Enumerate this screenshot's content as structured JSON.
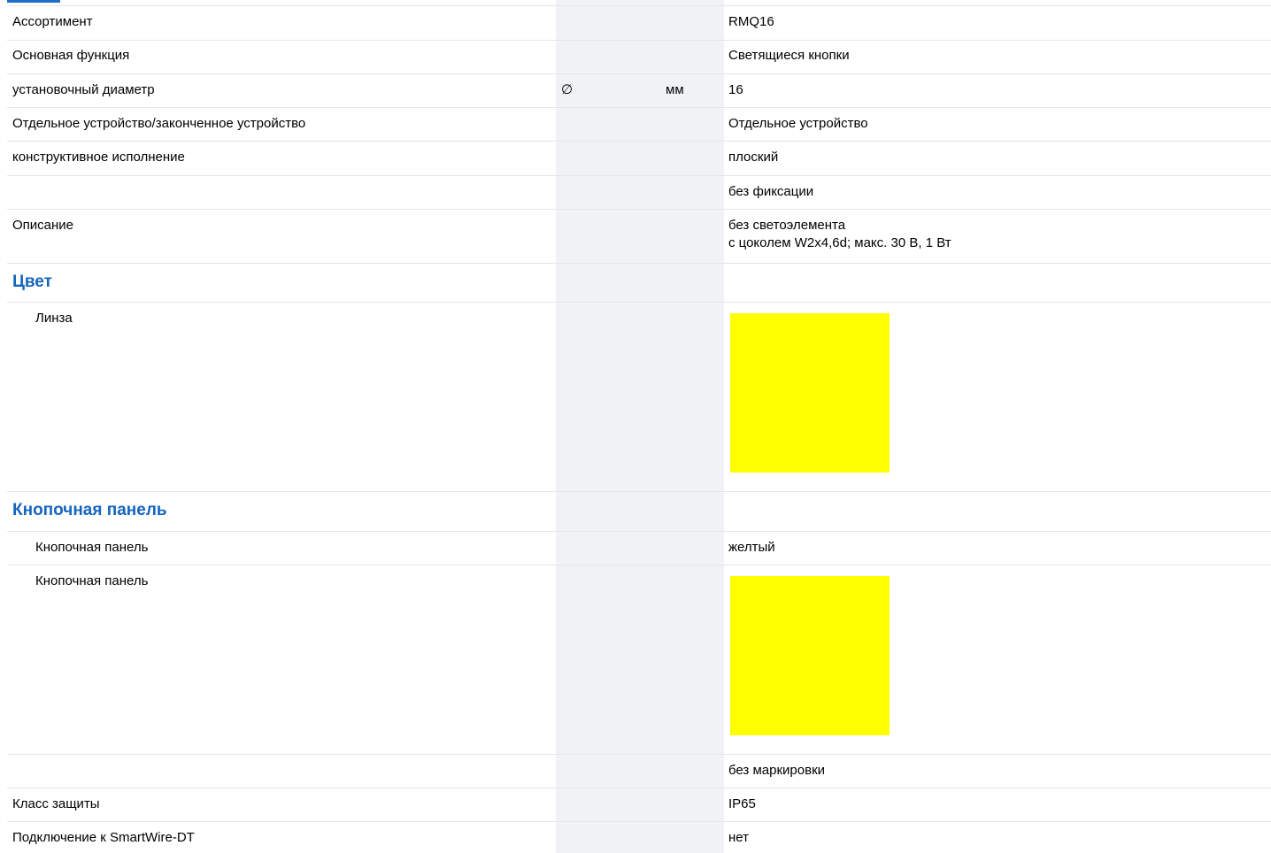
{
  "colors": {
    "section_title": "#1565c0",
    "symbol_column_bg": "#f1f2f5",
    "swatch_yellow": "#ffff00"
  },
  "rows": {
    "assortment": {
      "label": "Ассортимент",
      "value": "RMQ16"
    },
    "main_function": {
      "label": "Основная функция",
      "value": "Светящиеся кнопки"
    },
    "mount_diameter": {
      "label": "установочный диаметр",
      "symbol": "∅",
      "unit": "мм",
      "value": "16"
    },
    "device_type": {
      "label": "Отдельное устройство/законченное устройство",
      "value": "Отдельное устройство"
    },
    "design": {
      "label": "конструктивное исполнение",
      "value": "плоский"
    },
    "latching": {
      "value": "без фиксации"
    },
    "description": {
      "label": "Описание",
      "value": "без светоэлемента\nс цоколем W2x4,6d; макс. 30 В, 1 Вт"
    },
    "color_section": {
      "label": "Цвет"
    },
    "lens": {
      "label": "Линза",
      "swatch": "yellow"
    },
    "button_panel_section": {
      "label": "Кнопочная панель"
    },
    "button_panel_color": {
      "label": "Кнопочная панель",
      "value": "желтый"
    },
    "button_panel_swatch": {
      "label": "Кнопочная панель",
      "swatch": "yellow"
    },
    "marking": {
      "value": "без маркировки"
    },
    "protection_class": {
      "label": "Класс защиты",
      "value": "IP65"
    },
    "smartwire": {
      "label": "Подключение к SmartWire-DT",
      "value": "нет"
    }
  }
}
